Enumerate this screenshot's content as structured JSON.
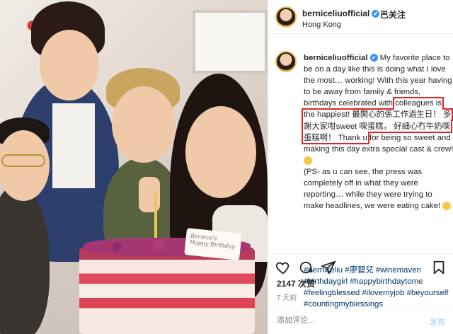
{
  "post": {
    "username": "berniceliuofficial",
    "verified_mark": "✔",
    "follow_separator": "•",
    "follow_label": "已关注",
    "location": "Hong Kong",
    "caption_before": " My favorite place to be on a day like this is doing what I love the most… working! With this year having to be away from family & friends, birthdays celebrated with ",
    "caption_highlight": "colleagues is the happiest! 最開心的係工作過生日！ 多謝大家咁sweet 㗎蛋糕， 好細心冇牛奶㗎蛋糕啊！ Thank u",
    "caption_after": " for being so sweet and making this day extra special cast & crew! ",
    "caption_ps": "(PS- as u can see, the press was completely off in what they were reporting… while they were trying to make headlines, we were eating cake! ",
    "hashtags": "#berniceliu #廖碧兒 #winemaven #birthdaygirl #happybirthdaytome #feelingblessed #ilovemyjob #beyourself #countingmyblessings",
    "likes": "2147 次赞",
    "time_ago": "7 天前",
    "comment_placeholder": "添加评论...",
    "post_button": "发布",
    "more_icon": "more-dots-icon"
  },
  "photo": {
    "plaque_text": "Bernice's Happy Birthday"
  },
  "colors": {
    "highlight_box": "#e0252a",
    "hashtag": "#00376b",
    "verified": "#3897f0"
  }
}
